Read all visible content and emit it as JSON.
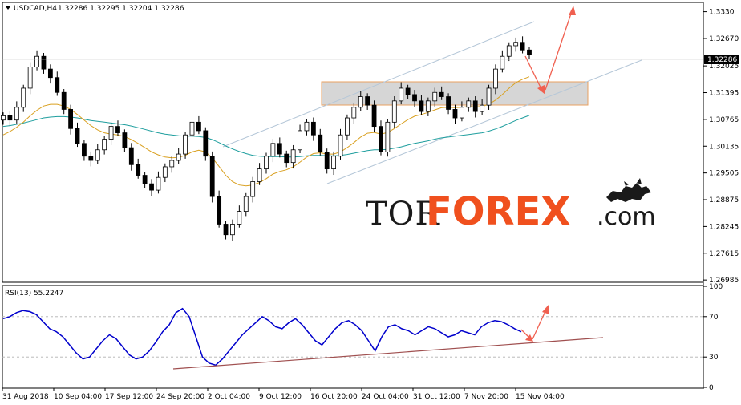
{
  "header": {
    "symbol": "USDCAD,H4",
    "ohlc": "1.32286  1.32295  1.32204  1.32286",
    "current_price": "1.32286"
  },
  "rsi_header": "RSI(13) 55.2247",
  "brand": {
    "part1": "TOR",
    "part2": "FOREX",
    "part3": ".com"
  },
  "colors": {
    "candle": "#000000",
    "ma_fast": "#d9a020",
    "ma_slow": "#1e9e9e",
    "channel": "#b5c7d8",
    "zone_fill": "#cccccc",
    "zone_border": "#e8a060",
    "arrow": "#f06050",
    "rsi_line": "#0000cc",
    "rsi_trend": "#a05050",
    "price_tag_bg": "#000000"
  },
  "chart_data": [
    {
      "type": "candlestick",
      "title": "USDCAD,H4",
      "x_ticks": [
        "31 Aug 2018",
        "10 Sep 04:00",
        "17 Sep 12:00",
        "24 Sep 20:00",
        "2 Oct 04:00",
        "9 Oct 12:00",
        "16 Oct 20:00",
        "24 Oct 04:00",
        "31 Oct 12:00",
        "7 Nov 20:00",
        "15 Nov 04:00"
      ],
      "y_ticks": [
        1.333,
        1.3267,
        1.32025,
        1.31395,
        1.30765,
        1.30135,
        1.29505,
        1.28875,
        1.28245,
        1.27615,
        1.26985
      ],
      "ylim": [
        1.2695,
        1.335
      ],
      "closes": [
        1.3085,
        1.3075,
        1.3105,
        1.315,
        1.32,
        1.3225,
        1.3195,
        1.3175,
        1.314,
        1.31,
        1.3055,
        1.302,
        1.299,
        1.298,
        1.3005,
        1.303,
        1.306,
        1.3045,
        1.301,
        1.297,
        1.2945,
        1.2925,
        1.291,
        1.294,
        1.2965,
        1.298,
        1.2995,
        1.304,
        1.307,
        1.305,
        1.299,
        1.2895,
        1.283,
        1.2805,
        1.283,
        1.286,
        1.2895,
        1.293,
        1.296,
        1.299,
        1.302,
        1.2995,
        1.2975,
        1.3005,
        1.305,
        1.307,
        1.304,
        1.3,
        1.296,
        1.299,
        1.304,
        1.308,
        1.3105,
        1.313,
        1.311,
        1.306,
        1.3,
        1.307,
        1.312,
        1.315,
        1.3135,
        1.312,
        1.3095,
        1.312,
        1.314,
        1.313,
        1.31,
        1.308,
        1.3105,
        1.312,
        1.3095,
        1.311,
        1.315,
        1.3195,
        1.3225,
        1.325,
        1.3258,
        1.324,
        1.3229
      ],
      "series": [
        {
          "name": "",
          "kind": "ma_fast",
          "values": [
            1.304,
            1.3048,
            1.3058,
            1.307,
            1.3085,
            1.3098,
            1.3108,
            1.3112,
            1.3112,
            1.3108,
            1.31,
            1.3088,
            1.3075,
            1.3062,
            1.3052,
            1.3045,
            1.3042,
            1.304,
            1.3036,
            1.3029,
            1.302,
            1.301,
            1.3,
            1.2993,
            1.2988,
            1.2986,
            1.2987,
            1.2992,
            1.3,
            1.3004,
            1.3,
            1.2986,
            1.2966,
            1.2945,
            1.293,
            1.2922,
            1.292,
            1.2922,
            1.2928,
            1.2937,
            1.2948,
            1.2954,
            1.2958,
            1.2965,
            1.2976,
            1.2988,
            1.2996,
            1.2998,
            1.2995,
            1.2995,
            1.3,
            1.301,
            1.3022,
            1.3035,
            1.3044,
            1.3046,
            1.3042,
            1.3046,
            1.3055,
            1.3066,
            1.3076,
            1.3084,
            1.3088,
            1.3093,
            1.3099,
            1.3104,
            1.3105,
            1.3104,
            1.3105,
            1.3107,
            1.3106,
            1.3107,
            1.3112,
            1.3122,
            1.3135,
            1.315,
            1.3163,
            1.3171,
            1.3177
          ]
        },
        {
          "name": "",
          "kind": "ma_slow",
          "values": [
            1.306,
            1.3062,
            1.3065,
            1.3068,
            1.3072,
            1.3076,
            1.308,
            1.3082,
            1.3083,
            1.3083,
            1.3082,
            1.308,
            1.3077,
            1.3074,
            1.3072,
            1.307,
            1.3068,
            1.3066,
            1.3064,
            1.3061,
            1.3057,
            1.3053,
            1.3049,
            1.3045,
            1.3042,
            1.304,
            1.3038,
            1.3037,
            1.3037,
            1.3036,
            1.3034,
            1.3029,
            1.3022,
            1.3014,
            1.3007,
            1.3001,
            1.2996,
            1.2992,
            1.299,
            1.2989,
            1.2989,
            1.2989,
            1.2988,
            1.2988,
            1.2989,
            1.2991,
            1.2992,
            1.2992,
            1.2991,
            1.2991,
            1.2992,
            1.2994,
            1.2997,
            1.3,
            1.3003,
            1.3005,
            1.3005,
            1.3006,
            1.3009,
            1.3012,
            1.3016,
            1.302,
            1.3023,
            1.3026,
            1.303,
            1.3033,
            1.3035,
            1.3037,
            1.3039,
            1.3041,
            1.3043,
            1.3045,
            1.3049,
            1.3054,
            1.306,
            1.3067,
            1.3074,
            1.308,
            1.3086
          ]
        }
      ]
    },
    {
      "type": "line",
      "title": "RSI(13) 55.2247",
      "y_ticks": [
        100,
        70,
        30,
        0
      ],
      "ylim": [
        0,
        100
      ],
      "series": [
        {
          "name": "RSI(13)",
          "values": [
            68,
            70,
            74,
            76,
            75,
            72,
            65,
            58,
            55,
            50,
            42,
            34,
            28,
            30,
            38,
            46,
            52,
            48,
            40,
            32,
            28,
            30,
            36,
            45,
            55,
            62,
            74,
            78,
            70,
            50,
            30,
            24,
            22,
            28,
            36,
            44,
            52,
            58,
            64,
            70,
            66,
            60,
            58,
            64,
            68,
            62,
            54,
            46,
            42,
            50,
            58,
            64,
            66,
            62,
            56,
            46,
            36,
            50,
            60,
            62,
            58,
            56,
            52,
            56,
            60,
            58,
            54,
            50,
            52,
            56,
            54,
            52,
            60,
            64,
            66,
            65,
            62,
            58,
            55
          ]
        }
      ]
    }
  ]
}
